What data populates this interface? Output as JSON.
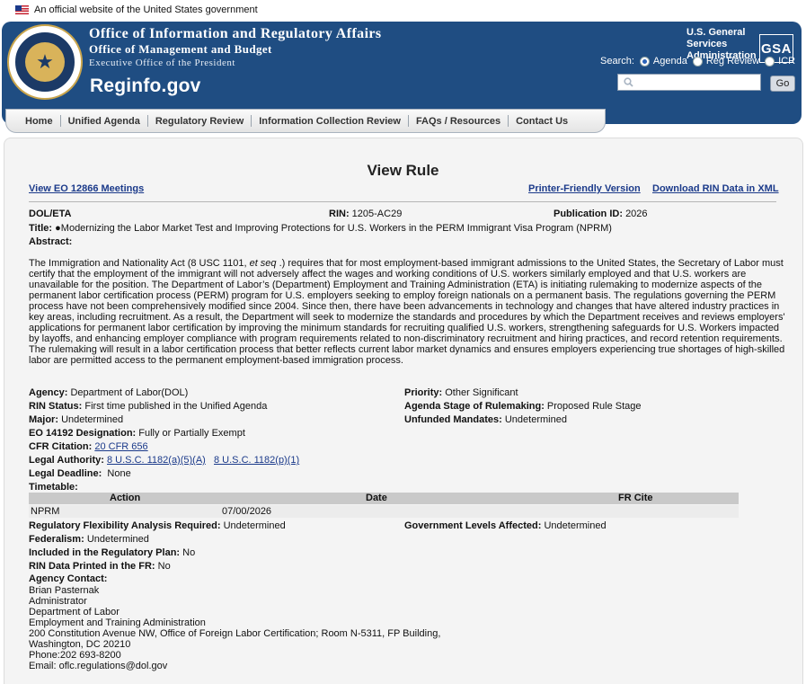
{
  "gov_banner": {
    "text": "An official website of the United States government"
  },
  "header": {
    "agency_line1": "Office of Information and Regulatory Affairs",
    "agency_line2": "Office of Management and Budget",
    "agency_line3": "Executive Office of the President",
    "brand": "Reginfo.gov",
    "gsa_line1": "U.S. General",
    "gsa_line2": "Services",
    "gsa_line3": "Administration",
    "gsa_logo": "GSA",
    "search_label": "Search:",
    "search_options": [
      "Agenda",
      "Reg Review",
      "ICR"
    ],
    "search_selected": "Agenda",
    "search_placeholder": "",
    "go_label": "Go"
  },
  "nav": {
    "items": [
      "Home",
      "Unified Agenda",
      "Regulatory Review",
      "Information Collection Review",
      "FAQs / Resources",
      "Contact Us"
    ]
  },
  "page": {
    "title": "View Rule",
    "link_eo": "View EO 12866 Meetings",
    "link_printer": "Printer-Friendly Version",
    "link_xml": "Download RIN Data in XML"
  },
  "rule": {
    "agency_code": "DOL/ETA",
    "rin_label": "RIN:",
    "rin": "1205-AC29",
    "pubid_label": "Publication ID:",
    "pubid": "2026",
    "title_label": "Title:",
    "title": "●Modernizing the Labor Market Test and Improving Protections for U.S. Workers in the PERM Immigrant Visa Program (NPRM)",
    "abstract_label": "Abstract:",
    "abstract_lines": [
      "The Immigration and Nationality Act (8 USC 1101, et seq .) requires that for most employment-based immigrant admissions to the United States, the Secretary of Labor must",
      "certify that the employment of the immigrant will not adversely affect the wages and working conditions of U.S. workers similarly employed and that U.S. workers are",
      "unavailable for the position. The Department of Labor’s (Department) Employment and Training Administration (ETA) is initiating rulemaking to modernize aspects of the",
      "permanent labor certification process (PERM) program for U.S. employers seeking to employ foreign nationals on a permanent basis. The regulations governing the PERM",
      "process have not been comprehensively modified since 2004.  Since then, there have been advancements in technology and changes that have altered industry practices in",
      "key areas, including recruitment. As a result, the Department will seek to modernize the standards and procedures by which the Department receives and reviews employers'",
      "applications for permanent labor certification by improving the minimum standards for recruiting qualified U.S. workers, strengthening safeguards for U.S. Workers impacted",
      "by layoffs, and enhancing employer compliance with program requirements related to non-discriminatory recruitment and hiring practices, and record retention requirements.",
      "The rulemaking will result in a labor certification process that better reflects current labor market dynamics and ensures employers experiencing true shortages of high-skilled",
      "labor are permitted access to the permanent employment-based immigration process."
    ],
    "agency_label": "Agency:",
    "agency": "Department of Labor(DOL)",
    "priority_label": "Priority:",
    "priority": "Other Significant",
    "rin_status_label": "RIN Status:",
    "rin_status": "First time published in the Unified Agenda",
    "stage_label": "Agenda Stage of Rulemaking:",
    "stage": "Proposed Rule Stage",
    "major_label": "Major:",
    "major": "Undetermined",
    "unfunded_label": "Unfunded Mandates:",
    "unfunded": "Undetermined",
    "eo_label": "EO 14192 Designation:",
    "eo": "Fully or Partially Exempt",
    "cfr_label": "CFR Citation:",
    "cfr": "20 CFR 656",
    "authority_label": "Legal Authority:",
    "authority_1": "8 U.S.C. 1182(a)(5)(A)",
    "authority_2": "8 U.S.C. 1182(p)(1)",
    "deadline_label": "Legal Deadline:",
    "deadline": "None",
    "timetable_label": "Timetable:",
    "timetable_headers": [
      "Action",
      "Date",
      "FR Cite"
    ],
    "timetable_rows": [
      {
        "action": "NPRM",
        "date": "07/00/2026",
        "fr_cite": ""
      }
    ],
    "rfa_label": "Regulatory Flexibility Analysis Required:",
    "rfa": "Undetermined",
    "gov_levels_label": "Government Levels Affected:",
    "gov_levels": "Undetermined",
    "federalism_label": "Federalism:",
    "federalism": "Undetermined",
    "plan_label": "Included in the Regulatory Plan:",
    "plan": "No",
    "printed_label": "RIN Data Printed in the FR:",
    "printed": "No",
    "contact_label": "Agency Contact:",
    "contact_lines": [
      "Brian Pasternak",
      "Administrator",
      "Department of Labor",
      "Employment and Training Administration",
      "200 Constitution Avenue NW, Office of Foreign Labor Certification; Room N-5311, FP Building,",
      "Washington, DC 20210",
      "Phone:202 693-8200",
      "Email: oflc.regulations@dol.gov"
    ]
  }
}
